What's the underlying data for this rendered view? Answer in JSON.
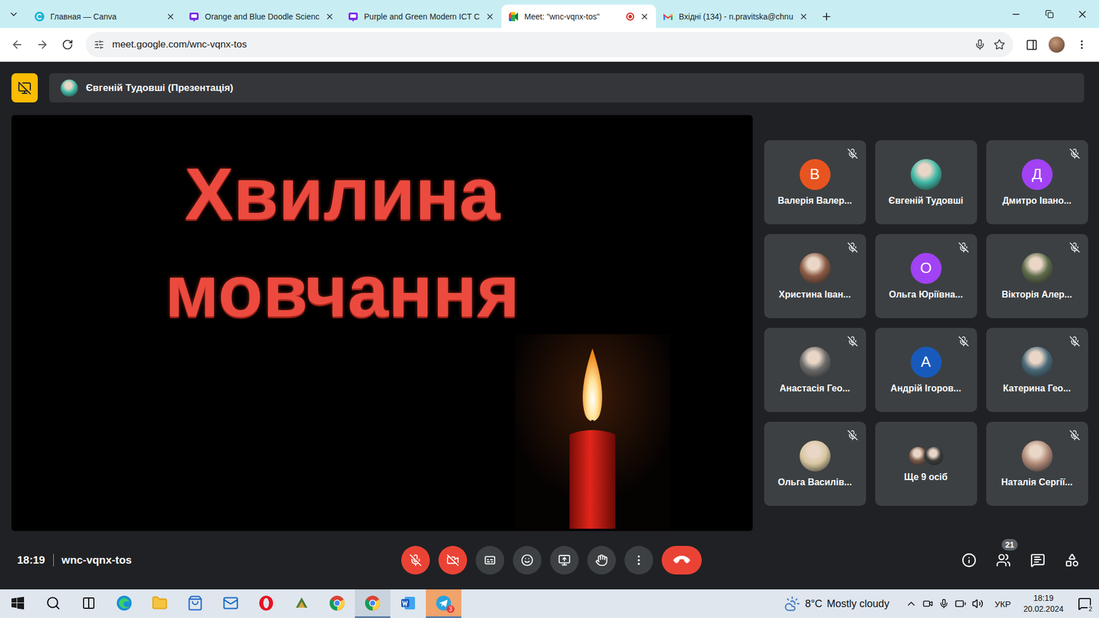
{
  "browser": {
    "tabs": [
      {
        "label": "Главная — Canva",
        "kind": "canva",
        "selected": false,
        "recording": false
      },
      {
        "label": "Orange and Blue Doodle Scienc",
        "kind": "canva-doc",
        "selected": false,
        "recording": false
      },
      {
        "label": "Purple and Green Modern ICT C",
        "kind": "canva-doc",
        "selected": false,
        "recording": false
      },
      {
        "label": "Meet: \"wnc-vqnx-tos\"",
        "kind": "meet",
        "selected": true,
        "recording": true
      },
      {
        "label": "Вхідні (134) - n.pravitska@chnu",
        "kind": "gmail",
        "selected": false,
        "recording": false
      }
    ],
    "url": "meet.google.com/wnc-vqnx-tos"
  },
  "meet": {
    "presenter": {
      "label": "Євгеній Тудовші (Презентація)",
      "color": "#3fb8a6"
    },
    "slide": {
      "lines": [
        "Хвилина",
        "мовчання"
      ]
    },
    "participants": [
      {
        "name": "Валерія Валер...",
        "kind": "letter",
        "initial": "В",
        "color": "#e8541f",
        "muted": true
      },
      {
        "name": "Євгеній Тудовші",
        "kind": "photo",
        "color": "#3fb8a6",
        "muted": false
      },
      {
        "name": "Дмитро Івано...",
        "kind": "letter",
        "initial": "Д",
        "color": "#a142f4",
        "muted": true
      },
      {
        "name": "Христина Іван...",
        "kind": "photo",
        "color": "#8a5a44",
        "muted": true
      },
      {
        "name": "Ольга Юріївна...",
        "kind": "letter",
        "initial": "О",
        "color": "#a142f4",
        "muted": true
      },
      {
        "name": "Вікторія Алер...",
        "kind": "photo",
        "color": "#5d6b4a",
        "muted": true
      },
      {
        "name": "Анастасія Гео...",
        "kind": "photo",
        "color": "#6b6b6b",
        "muted": true
      },
      {
        "name": "Андрій Ігоров...",
        "kind": "letter",
        "initial": "А",
        "color": "#185abc",
        "muted": true
      },
      {
        "name": "Катерина Гео...",
        "kind": "photo",
        "color": "#4a6a7a",
        "muted": true
      },
      {
        "name": "Ольга Василів...",
        "kind": "photo",
        "color": "#d8c7a0",
        "muted": true
      },
      {
        "name": "Ще 9 осіб",
        "kind": "group",
        "colors": [
          "#7a5a48",
          "#3a3a3a"
        ],
        "muted": false
      },
      {
        "name": "Наталія Сергії...",
        "kind": "photo",
        "color": "#b08a78",
        "muted": true
      }
    ]
  },
  "controls": {
    "time": "18:19",
    "code": "wnc-vqnx-tos",
    "mic_on": false,
    "camera_on": false,
    "captions_on": false,
    "people_count": "21"
  },
  "taskbar": {
    "apps": [
      {
        "kind": "search",
        "active": false,
        "flashing": false
      },
      {
        "kind": "taskview",
        "active": false,
        "flashing": false
      },
      {
        "kind": "edge",
        "active": false,
        "flashing": false
      },
      {
        "kind": "explorer",
        "active": false,
        "flashing": false
      },
      {
        "kind": "store",
        "active": false,
        "flashing": false
      },
      {
        "kind": "mail",
        "active": false,
        "flashing": false
      },
      {
        "kind": "opera",
        "active": false,
        "flashing": false
      },
      {
        "kind": "other",
        "active": false,
        "flashing": false
      },
      {
        "kind": "chrome",
        "active": false,
        "flashing": false
      },
      {
        "kind": "chrome",
        "active": true,
        "flashing": false
      },
      {
        "kind": "word",
        "active": false,
        "flashing": false
      },
      {
        "kind": "telegram",
        "active": false,
        "flashing": true,
        "badge": "3"
      }
    ],
    "weather": {
      "temp": "8°C",
      "text": "Mostly cloudy"
    },
    "language": "УКР",
    "time": "18:19",
    "date": "20.02.2024",
    "notifications": "2"
  }
}
